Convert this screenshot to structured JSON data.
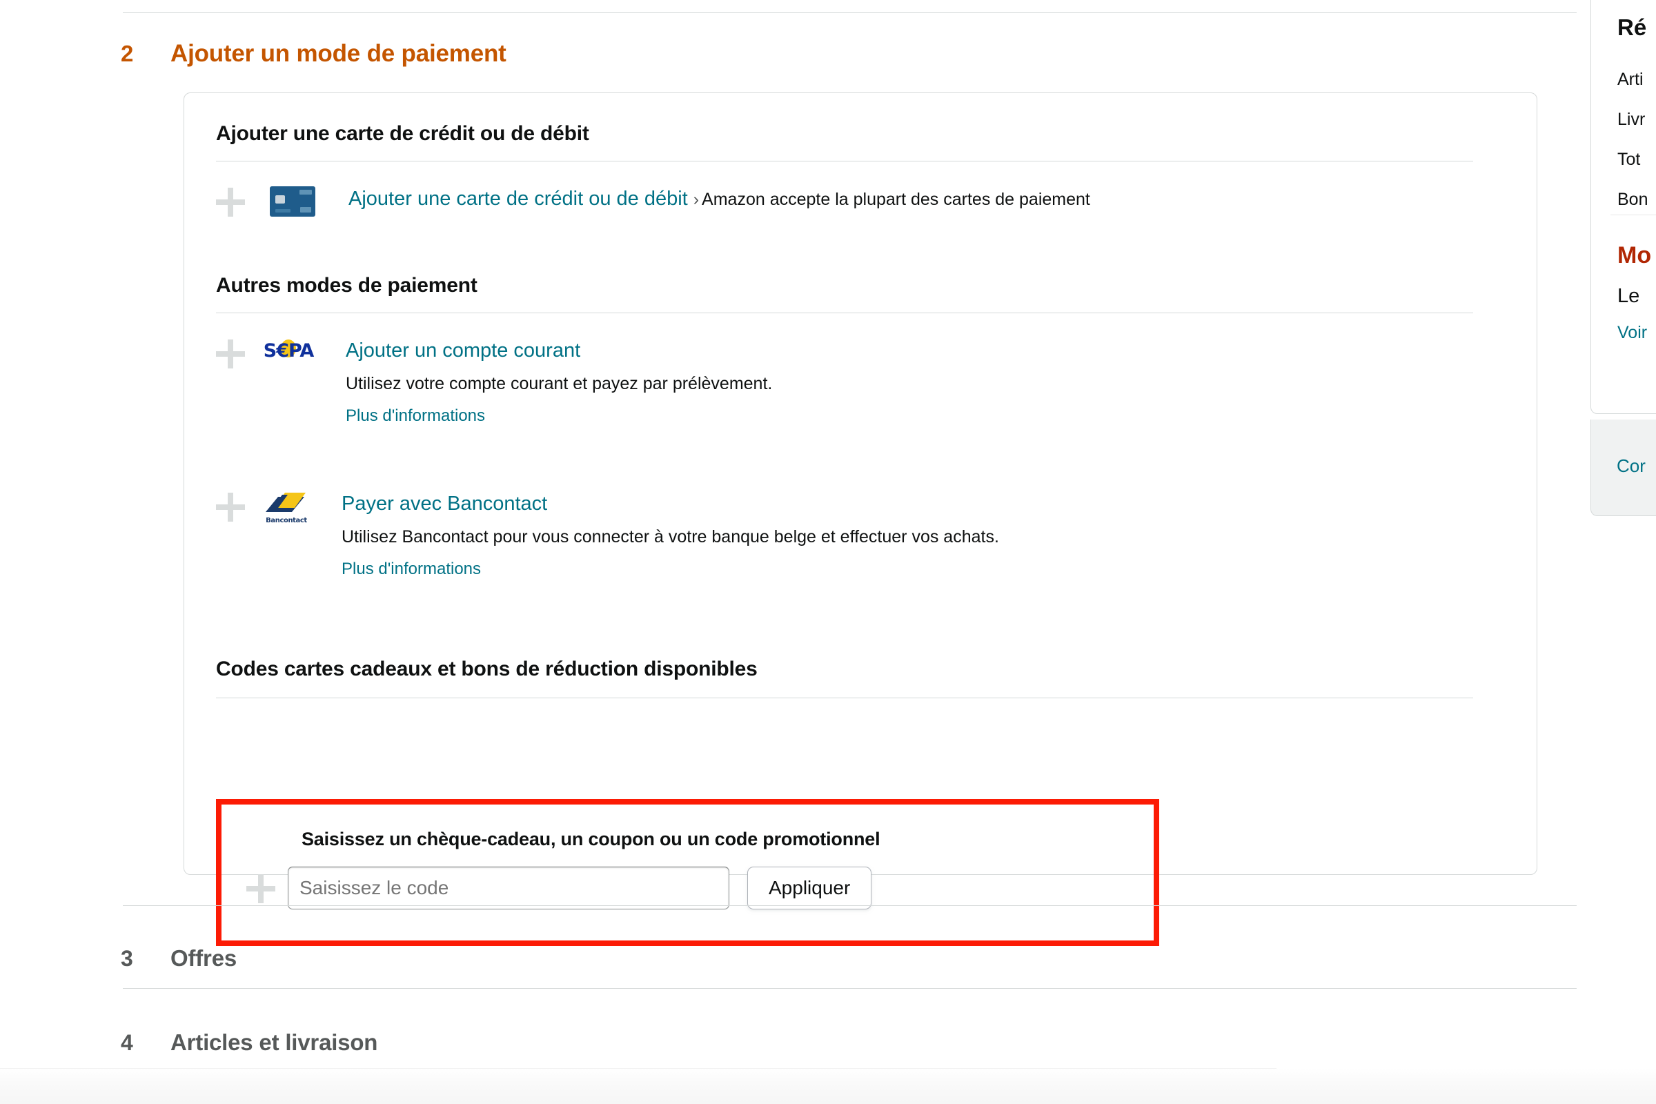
{
  "steps": {
    "payment": {
      "number": "2",
      "title": "Ajouter un mode de paiement"
    },
    "offers": {
      "number": "3",
      "title": "Offres"
    },
    "items": {
      "number": "4",
      "title": "Articles et livraison"
    }
  },
  "panel": {
    "card_section": {
      "title": "Ajouter une carte de crédit ou de débit",
      "option": {
        "link": "Ajouter une carte de crédit ou de débit",
        "chevron": "›",
        "note": "Amazon accepte la plupart des cartes de paiement",
        "icon": "credit-card-icon"
      }
    },
    "other_section": {
      "title": "Autres modes de paiement",
      "options": [
        {
          "icon": "sepa-logo-icon",
          "link": "Ajouter un compte courant",
          "description": "Utilisez votre compte courant et payez par prélèvement.",
          "more": "Plus d'informations"
        },
        {
          "icon": "bancontact-logo-icon",
          "link": "Payer avec Bancontact",
          "description": "Utilisez Bancontact pour vous connecter à votre banque belge et effectuer vos achats.",
          "more": "Plus d'informations"
        }
      ]
    },
    "giftcard_section": {
      "title": "Codes cartes cadeaux et bons de réduction disponibles",
      "label": "Saisissez un chèque-cadeau, un coupon ou un code promotionnel",
      "input_placeholder": "Saisissez le code",
      "input_value": "",
      "apply_label": "Appliquer",
      "highlight_color": "#fc1b05"
    }
  },
  "sidebar": {
    "title": "Ré",
    "lines": [
      "Arti",
      "Livr",
      "Tot",
      "Bon"
    ],
    "total_label": "Mo",
    "subtitle": "Le ",
    "link": "Voir",
    "footer_link": "Cor"
  },
  "colors": {
    "accent_orange": "#c45500",
    "link_teal": "#007185",
    "price_red": "#b12704",
    "highlight_red": "#fc1b05",
    "muted_gray": "#565959",
    "border_gray": "#d5d9d9"
  },
  "sepa_logo": {
    "prefix": "S",
    "euro": "€",
    "suffix": "PA"
  },
  "bancontact_logo": {
    "label": "Bancontact"
  }
}
